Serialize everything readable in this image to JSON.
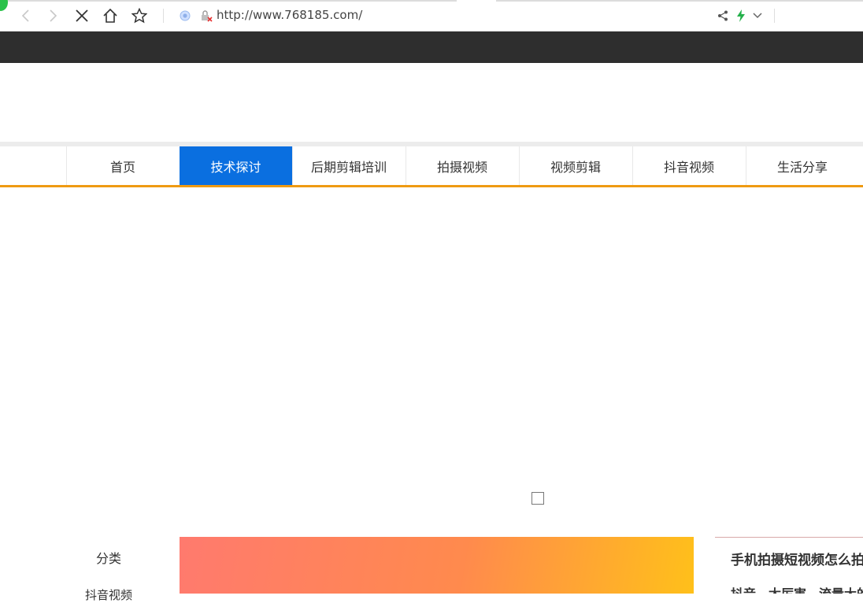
{
  "browser": {
    "url": "http://www.768185.com/",
    "icons": [
      "back-icon",
      "forward-icon",
      "stop-icon",
      "home-icon",
      "star-icon",
      "shield-icon",
      "insecure-lock-icon",
      "share-icon",
      "lightning-icon",
      "chevron-down-icon"
    ],
    "accent": "#2ac24a"
  },
  "nav": {
    "items": [
      {
        "label": "首页"
      },
      {
        "label": "技术探讨"
      },
      {
        "label": "后期剪辑培训"
      },
      {
        "label": "拍摄视频"
      },
      {
        "label": "视频剪辑"
      },
      {
        "label": "抖音视频"
      },
      {
        "label": "生活分享"
      }
    ],
    "active_color": "#0a6fe0",
    "underline_color": "#ef9a12"
  },
  "sidebar": {
    "title": "分类",
    "items": [
      {
        "label": "抖音视频"
      }
    ]
  },
  "article": {
    "title": "手机拍摄短视频怎么拍",
    "tags": "抖音、太厉害，流量大的"
  }
}
